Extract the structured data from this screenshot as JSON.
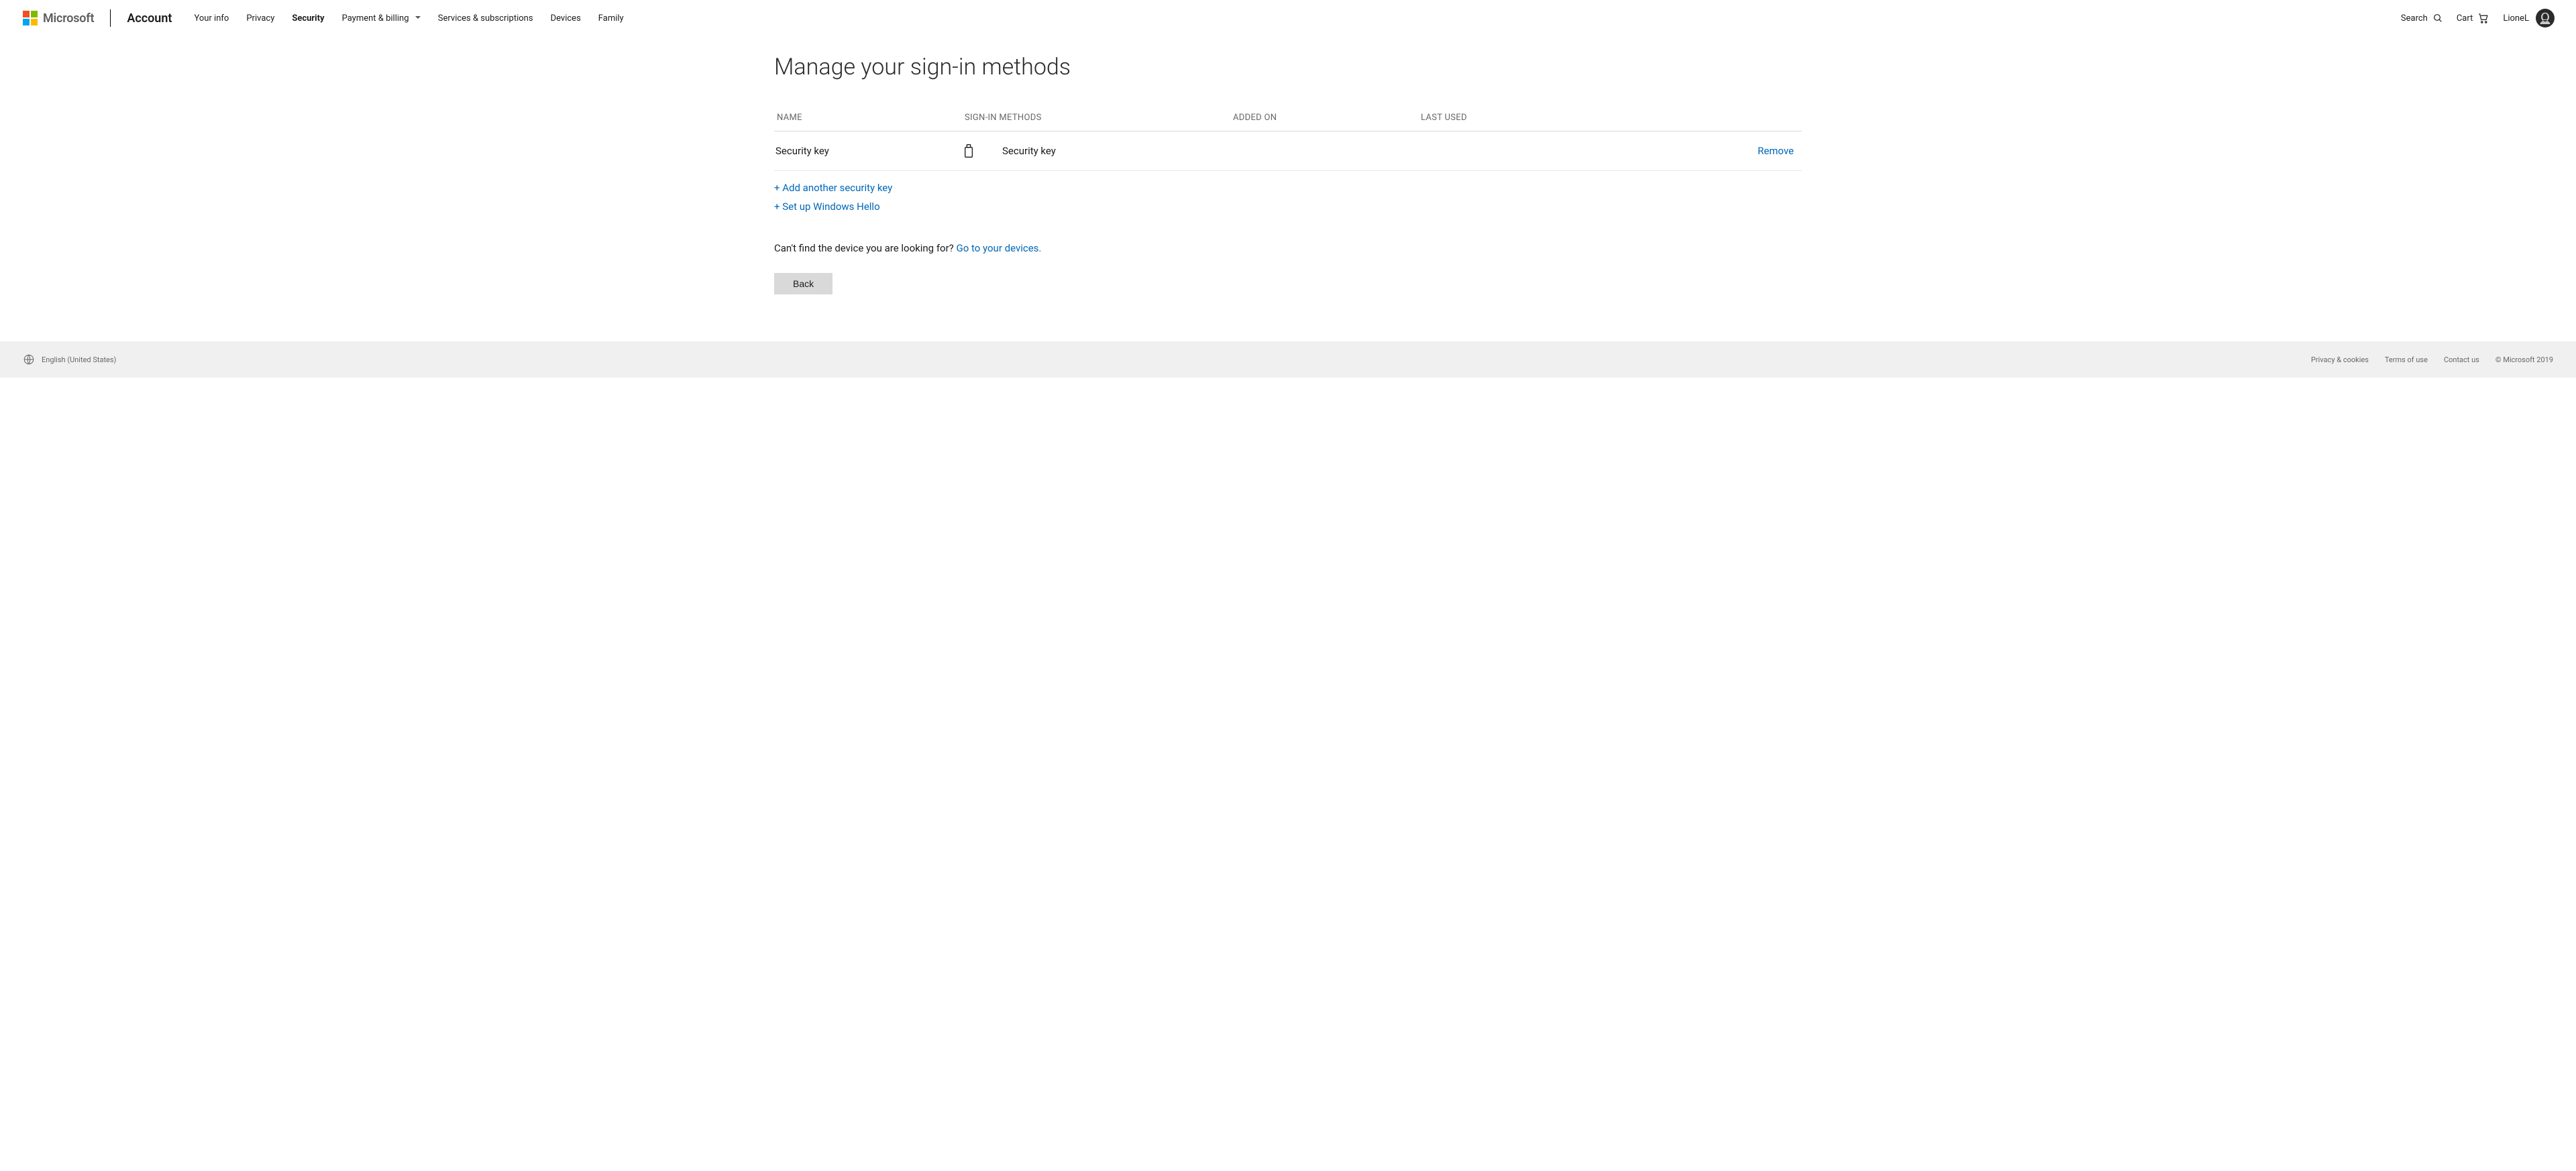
{
  "header": {
    "brand": "Microsoft",
    "section": "Account",
    "nav": {
      "your_info": "Your info",
      "privacy": "Privacy",
      "security": "Security",
      "payment_billing": "Payment & billing",
      "services": "Services & subscriptions",
      "devices": "Devices",
      "family": "Family"
    },
    "search_label": "Search",
    "cart_label": "Cart",
    "user_name": "LioneL"
  },
  "page": {
    "title": "Manage your sign-in methods",
    "columns": {
      "name": "NAME",
      "signin_methods": "SIGN-IN METHODS",
      "added_on": "ADDED ON",
      "last_used": "LAST USED"
    },
    "rows": [
      {
        "name": "Security key",
        "method": "Security key",
        "added_on": "",
        "last_used": "",
        "remove_label": "Remove"
      }
    ],
    "add_another_label": "+ Add another security key",
    "setup_hello_label": "+ Set up Windows Hello",
    "help_prefix": "Can't find the device you are looking for? ",
    "help_link": "Go to your devices.",
    "back_label": "Back"
  },
  "footer": {
    "language": "English (United States)",
    "links": {
      "privacy": "Privacy & cookies",
      "terms": "Terms of use",
      "contact": "Contact us"
    },
    "copyright": "© Microsoft 2019"
  }
}
